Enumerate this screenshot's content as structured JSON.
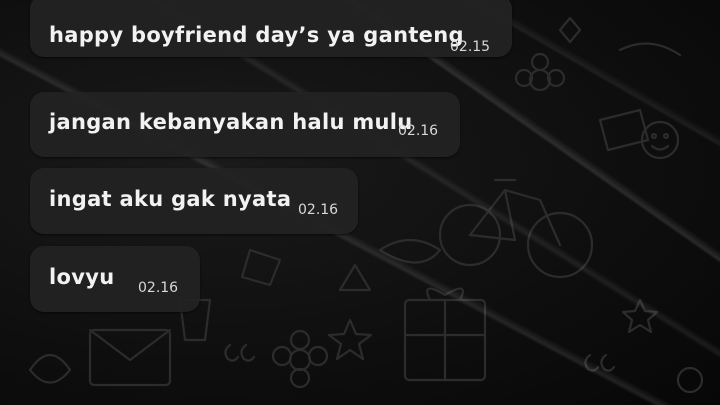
{
  "chat": {
    "messages": [
      {
        "text": "happy boyfriend day’s ya ganteng",
        "time": "02.15"
      },
      {
        "text": "jangan kebanyakan halu mulu",
        "time": "02.16"
      },
      {
        "text": "ingat aku gak nyata",
        "time": "02.16"
      },
      {
        "text": "lovyu",
        "time": "02.16"
      }
    ]
  },
  "theme": {
    "background": "#0e0e0e",
    "bubble": "#222222",
    "text": "#f2f2f2",
    "timestamp": "#d8d8d8"
  },
  "icons": [
    "bicycle-doodle-icon",
    "gift-doodle-icon",
    "star-doodle-icon",
    "quote-doodle-icon",
    "envelope-doodle-icon",
    "flower-doodle-icon"
  ]
}
